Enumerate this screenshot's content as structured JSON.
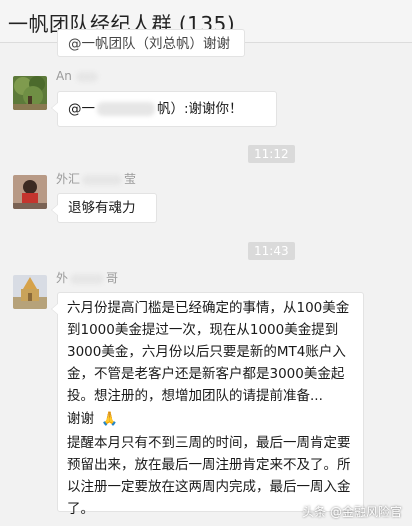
{
  "header": {
    "title": "一帆团队经纪人群 (135)"
  },
  "messages": [
    {
      "text": "@一帆团队（刘总帆）谢谢"
    },
    {
      "sender": "An",
      "mention_prefix": "@一",
      "mention_suffix": "帆）:谢谢你！"
    },
    {
      "time": "11:12"
    },
    {
      "sender_prefix": "外汇",
      "sender_suffix": "莹",
      "text": "退够有魂力"
    },
    {
      "time": "11:43"
    },
    {
      "sender_prefix": "外",
      "sender_suffix": "哥",
      "paragraphs": [
        "六月份提高门槛是已经确定的事情，从100美金到1000美金提过一次，现在从1000美金提到3000美金，六月份以后只要是新的MT4账户入金，不管是老客户还是新客户都是3000美金起投。想注册的，想增加团队的请提前准备...",
        "谢谢",
        "提醒本月只有不到三周的时间，最后一周肯定要预留出来，放在最后一周注册肯定来不及了。所以注册一定要放在这两周内完成，最后一周入金了。"
      ],
      "emoji": "🙏"
    }
  ],
  "watermark": "头条 @金融风险官"
}
